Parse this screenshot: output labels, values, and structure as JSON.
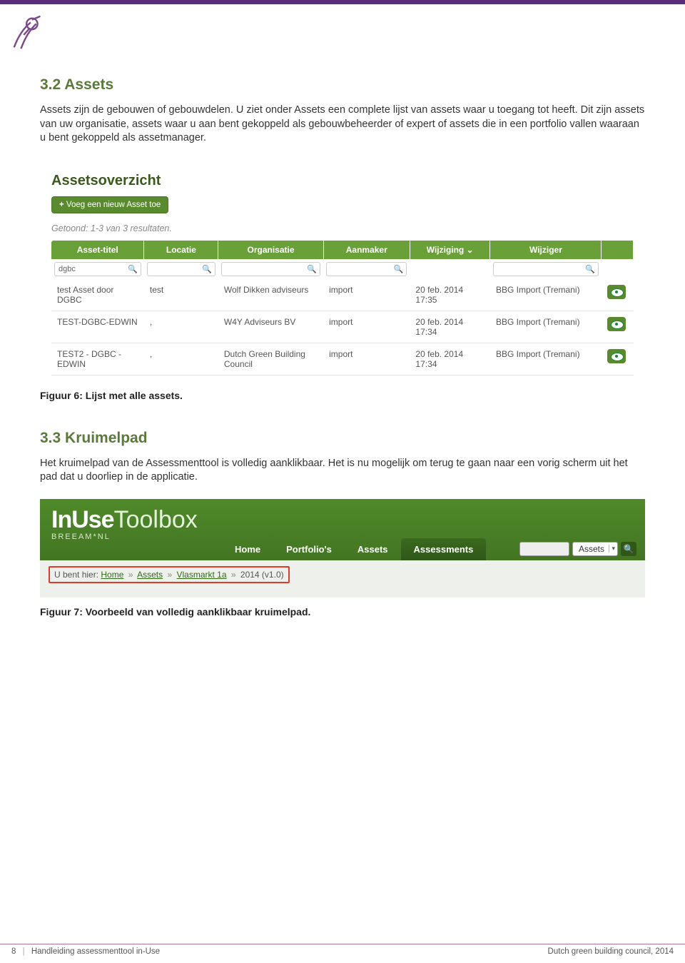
{
  "sections": {
    "s32_title": "3.2  Assets",
    "s32_body": "Assets zijn de gebouwen of gebouwdelen. U ziet onder Assets een complete lijst van assets waar u toegang tot heeft. Dit zijn assets van uw organisatie, assets waar u aan bent gekoppeld als gebouwbeheerder of expert of assets die in een portfolio vallen waaraan u bent gekoppeld als assetmanager.",
    "s32_caption": "Figuur 6: Lijst met alle assets.",
    "s33_title": "3.3  Kruimelpad",
    "s33_body": "Het kruimelpad van de Assessmenttool is volledig aanklikbaar. Het is nu mogelijk om terug te gaan naar een vorig scherm uit het pad dat u doorliep in de applicatie.",
    "s33_caption": "Figuur 7: Voorbeeld van volledig aanklikbaar kruimelpad."
  },
  "fig6": {
    "title": "Assetsoverzicht",
    "add_button": "Voeg een nieuw Asset toe",
    "shown": "Getoond: 1-3 van 3 resultaten.",
    "headers": {
      "title": "Asset-titel",
      "location": "Locatie",
      "org": "Organisatie",
      "creator": "Aanmaker",
      "modified": "Wijziging ⌄",
      "modifier": "Wijziger"
    },
    "filter_value": "dgbc",
    "rows": [
      {
        "title": "test Asset door DGBC",
        "loc": "test",
        "org": "Wolf Dikken adviseurs",
        "creator": "import",
        "mod": "20 feb. 2014 17:35",
        "by": "BBG Import (Tremani)"
      },
      {
        "title": "TEST-DGBC-EDWIN",
        "loc": ",",
        "org": "W4Y Adviseurs BV",
        "creator": "import",
        "mod": "20 feb. 2014 17:34",
        "by": "BBG Import (Tremani)"
      },
      {
        "title": "TEST2 - DGBC - EDWIN",
        "loc": ",",
        "org": "Dutch Green Building Council",
        "creator": "import",
        "mod": "20 feb. 2014 17:34",
        "by": "BBG Import (Tremani)"
      }
    ]
  },
  "fig7": {
    "brand_in": "InUse",
    "brand_tool": "Toolbox",
    "brand_sub": "BREEAM*NL",
    "nav": {
      "home": "Home",
      "port": "Portfolio's",
      "assets": "Assets",
      "assess": "Assessments"
    },
    "select_value": "Assets",
    "crumb_prefix": "U bent hier:",
    "crumb": {
      "home": "Home",
      "assets": "Assets",
      "vlas": "Vlasmarkt 1a",
      "tail": "2014 (v1.0)"
    }
  },
  "footer": {
    "page": "8",
    "left": "Handleiding assessmenttool in-Use",
    "right": "Dutch green building council, 2014"
  }
}
